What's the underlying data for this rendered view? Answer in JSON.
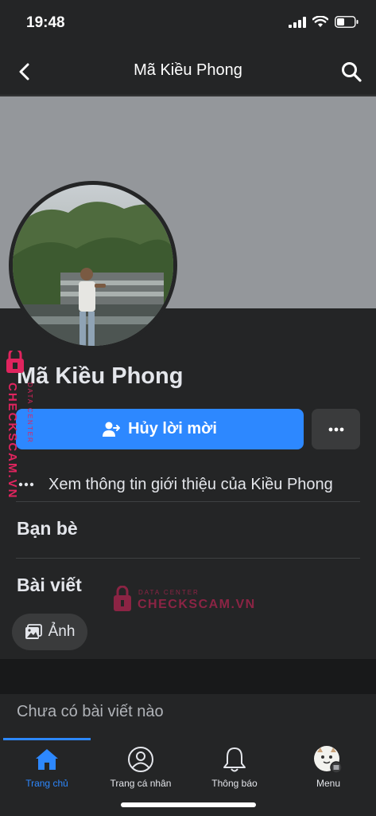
{
  "status_bar": {
    "time": "19:48"
  },
  "nav": {
    "title": "Mã Kiều Phong"
  },
  "profile": {
    "name": "Mã Kiều Phong",
    "primary_button_label": "Hủy lời mời",
    "intro_link": "Xem thông tin giới thiệu của Kiều Phong"
  },
  "sections": {
    "friends_title": "Bạn bè",
    "posts_title": "Bài viết",
    "photos_chip": "Ảnh",
    "empty_posts": "Chưa có bài viết nào"
  },
  "tabs": [
    {
      "label": "Trang chủ",
      "icon": "home-icon",
      "active": true
    },
    {
      "label": "Trang cá nhân",
      "icon": "profile-icon",
      "active": false
    },
    {
      "label": "Thông báo",
      "icon": "bell-icon",
      "active": false
    },
    {
      "label": "Menu",
      "icon": "menu-avatar-icon",
      "active": false
    }
  ],
  "watermark": {
    "brand": "CHECKSCAM.VN",
    "sub": "DATA CENTER"
  },
  "colors": {
    "accent": "#2d88ff",
    "background": "#242526",
    "cover": "#94979b",
    "watermark": "#e0245e"
  }
}
